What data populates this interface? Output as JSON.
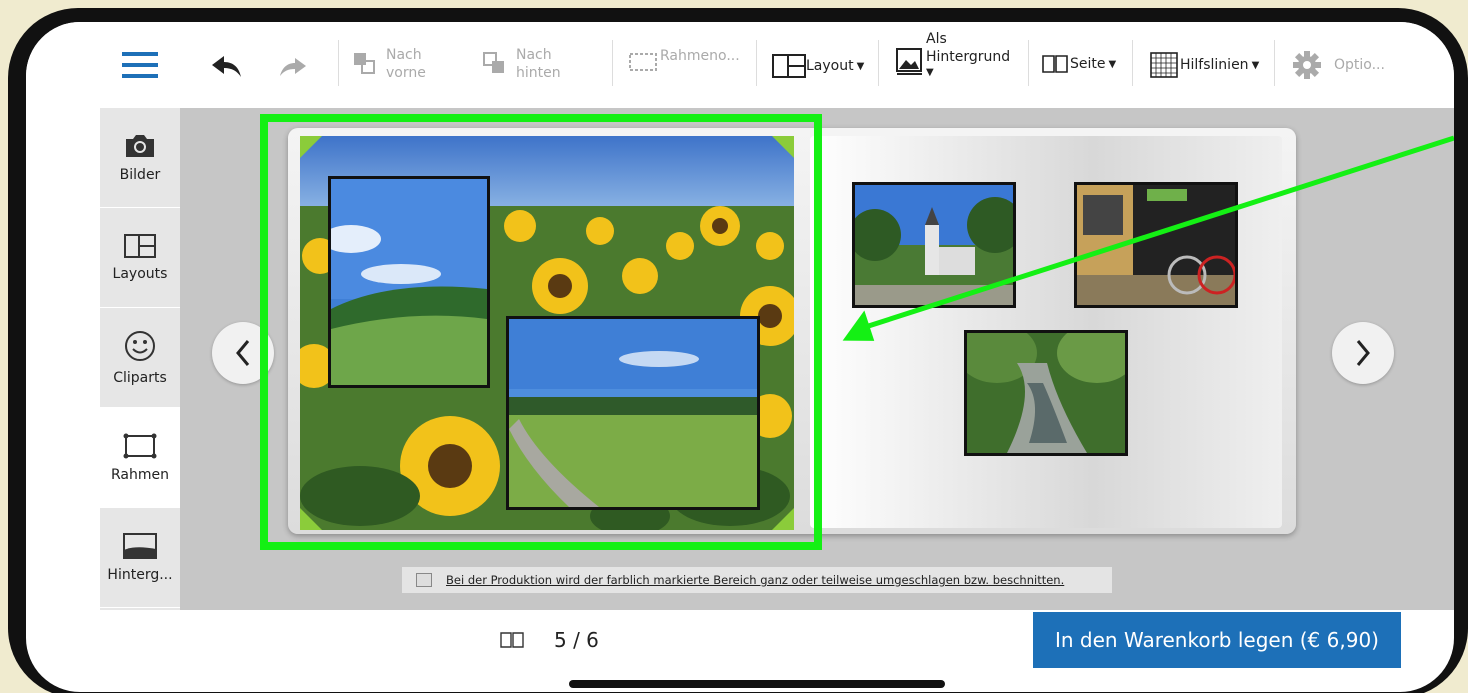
{
  "toolbar": {
    "nach_vorne": [
      "Nach",
      "vorne"
    ],
    "nach_hinten": [
      "Nach",
      "hinten"
    ],
    "rahmeno": "Rahmeno...",
    "layout": "Layout",
    "als_hintergrund": [
      "Als",
      "Hintergrund"
    ],
    "seite": "Seite",
    "hilfslinien": "Hilfslinien",
    "optio": "Optio..."
  },
  "sidebar": {
    "items": [
      {
        "label": "Bilder",
        "icon": "camera-icon"
      },
      {
        "label": "Layouts",
        "icon": "layout-icon"
      },
      {
        "label": "Cliparts",
        "icon": "smiley-icon"
      },
      {
        "label": "Rahmen",
        "icon": "frame-icon",
        "active": true
      },
      {
        "label": "Hinterg...",
        "icon": "background-icon"
      }
    ]
  },
  "canvas": {
    "note": "Bei der Produktion wird der farblich markierte Bereich ganz oder teilweise umgeschlagen bzw. beschnitten."
  },
  "footer": {
    "page_indicator": "5 / 6",
    "cart_button": "In den Warenkorb legen (€ 6,90)"
  },
  "colors": {
    "accent": "#1d70b8",
    "highlight": "#14f014"
  }
}
